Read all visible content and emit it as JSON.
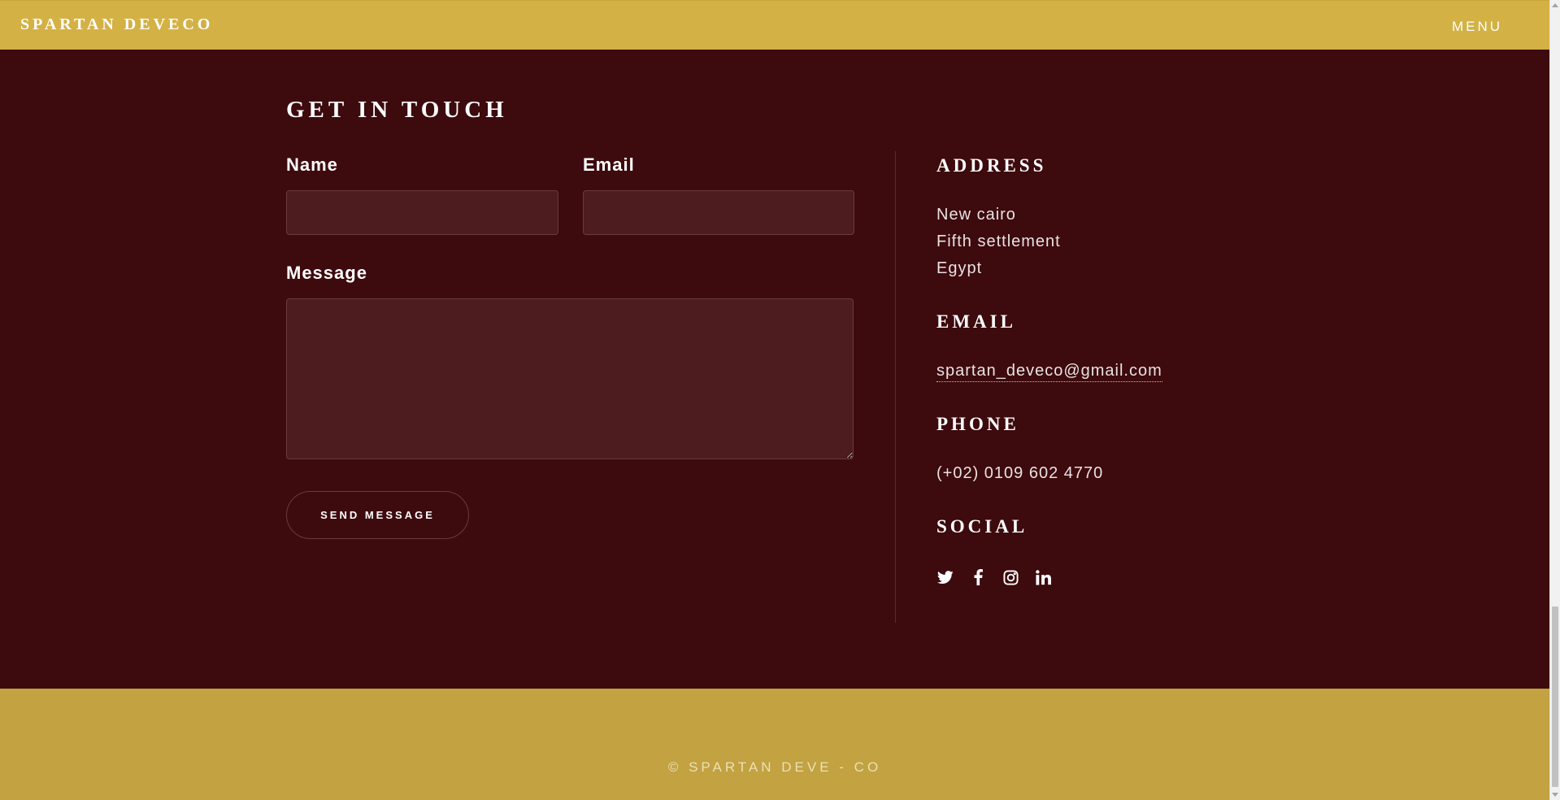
{
  "header": {
    "brand": "SPARTAN DEVECO",
    "menu_label": "MENU"
  },
  "contact_form": {
    "title": "GET IN TOUCH",
    "name_label": "Name",
    "name_value": "",
    "email_label": "Email",
    "email_value": "",
    "message_label": "Message",
    "message_value": "",
    "send_label": "SEND MESSAGE"
  },
  "info": {
    "address_heading": "ADDRESS",
    "address_lines": [
      "New cairo",
      "Fifth settlement",
      "Egypt"
    ],
    "email_heading": "EMAIL",
    "email_value": "spartan_deveco@gmail.com",
    "phone_heading": "PHONE",
    "phone_value": "(+02) 0109 602 4770",
    "social_heading": "SOCIAL",
    "social_icons": [
      "twitter-icon",
      "facebook-icon",
      "instagram-icon",
      "linkedin-icon"
    ]
  },
  "footer": {
    "copyright": "© SPARTAN DEVE - CO"
  },
  "colors": {
    "header_bg": "#d4b145",
    "main_bg": "#3d0a0d",
    "input_bg": "#4c1c1f",
    "footer_bg": "#c2a241"
  }
}
